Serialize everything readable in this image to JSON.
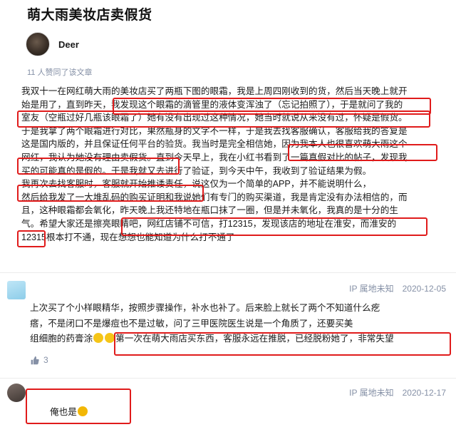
{
  "title": "萌大雨美妆店卖假货",
  "author": {
    "name": "Deer"
  },
  "likes_text": "11 人赞同了该文章",
  "article_lines": [
    "我双十一在网红萌大雨的美妆店买了两瓶下图的眼霜，我是上周四刚收到的货，然后当天晚上就开",
    "始是用了，直到昨天，我发现这个眼霜的滴管里的液体变浑浊了（忘记拍照了），于是就问了我的",
    "室友（空瓶过好几瓶该眼霜了）她有没有出现过这种情况，她当时就说从来没有过，怀疑是假货。",
    "于是我拿了两个眼霜进行对比，果然瓶身的文字不一样，于是我去找客服确认，客服给我的答复是",
    "这是国内版的，并且保证任何平台的验货。我当时是完全相信她，因为我本人也很喜欢萌大雨这个",
    "网红，我认为她没有理由卖假货。直到今天早上，我在小红书看到了一篇真假对比的帖子，发现我",
    "买的可能真的是假的。于是我就又去进行了验证，到今天中午，我收到了验证结果为假。",
    "我再次去找客服时，客服就开始推诿责任，说这仅为一个简单的APP，并不能说明什么，",
    "然后给我发了一大堆乱码的购买证明和我说她们有专门的购买渠道，我是肯定没有办法相信的，而",
    "且，这种眼霜都会氧化，昨天晚上我还特地在瓶口抹了一圈，但是并未氧化，我真的是十分的生",
    "气。希望大家还是擦亮眼睛吧，网红店铺不可信，打12315，发现该店的地址在淮安，而淮安的",
    "12315根本打不通，现在想想也能知道为什么打不通了"
  ],
  "comments": [
    {
      "ip": "IP 属地未知",
      "date": "2020-12-05",
      "lines": [
        "上次买了个小样眼精华，按照步骤操作，补水也补了。后来脸上就长了两个不知道什么疙",
        "瘩，不是闭口不是爆痘也不是过敏，问了三甲医院医生说是一个角质了，还要买美",
        "组细胞的药膏涂",
        "第一次在萌大雨店买东西，客服永远在推脱，已经脱粉她了，非常失望"
      ],
      "like_count": "3"
    },
    {
      "ip": "IP 属地未知",
      "date": "2020-12-17",
      "text": "俺也是"
    }
  ],
  "highlight_color": "#e01b1b",
  "meta_color": "#8590a6"
}
